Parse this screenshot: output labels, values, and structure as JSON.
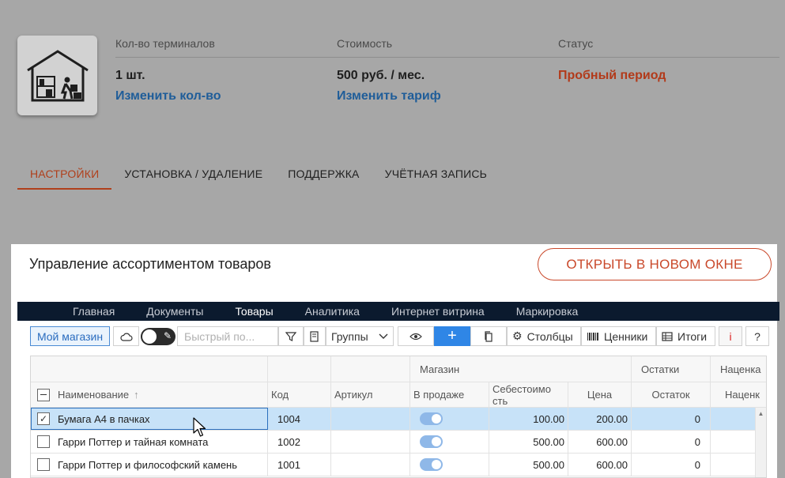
{
  "header": {
    "title_fragment": "",
    "terminals_label": "Кол-во терминалов",
    "terminals_value": "1 шт.",
    "terminals_link": "Изменить кол-во",
    "cost_label": "Стоимость",
    "cost_value": "500 руб. / мес.",
    "cost_link": "Изменить тариф",
    "status_label": "Статус",
    "status_value": "Пробный период",
    "status_color": "#b23a1a",
    "link_color": "#1f5d99"
  },
  "tabs": [
    {
      "label": "НАСТРОЙКИ",
      "active": true
    },
    {
      "label": "УСТАНОВКА / УДАЛЕНИЕ"
    },
    {
      "label": "ПОДДЕРЖКА"
    },
    {
      "label": "УЧЁТНАЯ ЗАПИСЬ"
    }
  ],
  "panel": {
    "title": "Управление ассортиментом товаров",
    "open_button": "ОТКРЫТЬ В НОВОМ ОКНЕ"
  },
  "app_nav": [
    "Главная",
    "Документы",
    "Товары",
    "Аналитика",
    "Интернет витрина",
    "Маркировка"
  ],
  "toolbar": {
    "store": "Мой магазин",
    "search_placeholder": "Быстрый по...",
    "groups": "Группы",
    "columns": "Столбцы",
    "price_tags": "Ценники",
    "totals": "Итоги",
    "info": "i",
    "help": "?"
  },
  "grid": {
    "group_headers": {
      "store": "Магазин",
      "stock": "Остатки",
      "markup": "Наценка"
    },
    "columns": {
      "name": "Наименование",
      "sort_indicator": "↑",
      "code": "Код",
      "article": "Артикул",
      "on_sale": "В продаже",
      "cost": "Себестоимо сть",
      "price": "Цена",
      "remainder": "Остаток",
      "markup": "Наценк"
    },
    "rows": [
      {
        "name": "Бумага А4 в пачках",
        "code": "1004",
        "cost": "100.00",
        "price": "200.00",
        "remainder": "0",
        "checked": true,
        "selected": true
      },
      {
        "name": "Гарри Поттер и тайная комната",
        "code": "1002",
        "cost": "500.00",
        "price": "600.00",
        "remainder": "0",
        "checked": false
      },
      {
        "name": "Гарри Поттер и философский камень",
        "code": "1001",
        "cost": "500.00",
        "price": "600.00",
        "remainder": "0",
        "checked": false
      }
    ]
  },
  "icons": [
    "warehouse-icon",
    "cloud-icon",
    "edit-icon",
    "filter-icon",
    "report-icon",
    "chevron-down-icon",
    "eye-icon",
    "plus-icon",
    "copy-icon",
    "gear-icon",
    "barcode-icon",
    "table-icon",
    "mouse-cursor-icon"
  ]
}
